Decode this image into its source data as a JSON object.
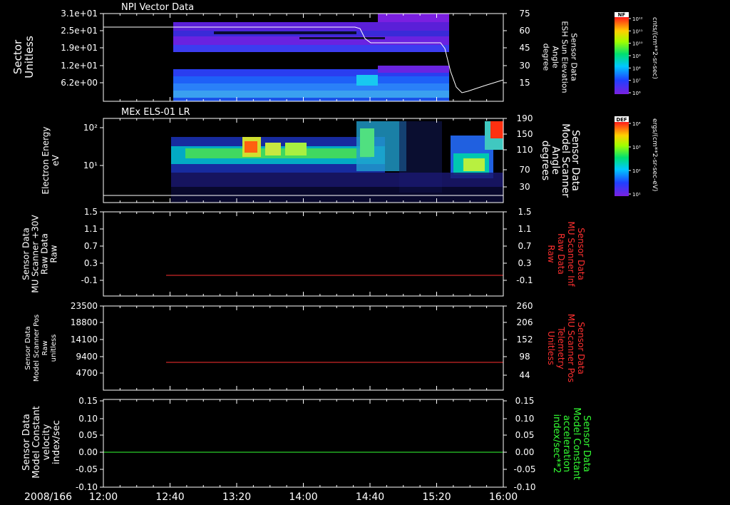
{
  "colors": {
    "background": "#000000",
    "axis": "#ffffff",
    "red_trace": "#ff3030",
    "green_trace": "#33ff33",
    "white_trace": "#ffffff"
  },
  "time_axis": {
    "date_label": "2008/166",
    "ticks": [
      "12:00",
      "12:40",
      "13:20",
      "14:00",
      "14:40",
      "15:20",
      "16:00"
    ]
  },
  "panels": [
    {
      "title": "NPI Vector Data",
      "left_label": [
        "Sector",
        "Unitless"
      ],
      "left_ticks": [
        "3.1e+01",
        "2.5e+01",
        "1.9e+01",
        "1.2e+01",
        "6.2e+00"
      ],
      "right_label": [
        "Sensor Data",
        "ESH Sun Elevation",
        "Angle",
        "degree"
      ],
      "right_ticks": [
        "75",
        "60",
        "45",
        "30",
        "15"
      ],
      "colorbar": {
        "label": "NF",
        "unit": "cnts/(cm**2-sr-sec)",
        "ticks": [
          "10¹²",
          "10¹¹",
          "10¹⁰",
          "10⁹",
          "10⁸",
          "10⁷",
          "10⁶"
        ]
      }
    },
    {
      "title": "MEx ELS-01 LR",
      "left_label": [
        "Electron Energy",
        "eV"
      ],
      "left_ticks": [
        "10²",
        "10¹"
      ],
      "right_label": [
        "Sensor Data",
        "Model Scanner",
        "Angle",
        "degrees"
      ],
      "right_ticks": [
        "190",
        "150",
        "110",
        "70",
        "30"
      ],
      "colorbar": {
        "label": "DEF",
        "unit": "ergs/(cm**2-sr-sec-eV)",
        "ticks": [
          "10⁴",
          "10³",
          "10²",
          "10¹"
        ]
      }
    },
    {
      "left_label": [
        "Sensor Data",
        "MU Scanner +30V",
        "Raw Data",
        "Raw"
      ],
      "left_ticks": [
        "1.5",
        "1.1",
        "0.7",
        "0.3",
        "-0.1"
      ],
      "right_label": [
        "Sensor Data",
        "MU Scanner Inf",
        "Raw Data",
        "Raw"
      ],
      "right_ticks": [
        "1.5",
        "1.1",
        "0.7",
        "0.3",
        "-0.1"
      ]
    },
    {
      "left_label": [
        "Sensor Data",
        "Model Scanner Pos",
        "Raw",
        "unitless"
      ],
      "left_ticks": [
        "23500",
        "18800",
        "14100",
        "9400",
        "4700"
      ],
      "right_label": [
        "Sensor Data",
        "MU Scanner Pos",
        "Telemetry",
        "Unitless"
      ],
      "right_ticks": [
        "260",
        "206",
        "152",
        "98",
        "44"
      ]
    },
    {
      "left_label": [
        "Sensor Data",
        "Model Constant",
        "velocity",
        "index/sec"
      ],
      "left_ticks": [
        "0.15",
        "0.10",
        "0.05",
        "0.00",
        "-0.05",
        "-0.10"
      ],
      "right_label": [
        "Sensor Data",
        "Model Constant",
        "acceleration",
        "index/sec**2"
      ],
      "right_ticks": [
        "0.15",
        "0.10",
        "0.05",
        "0.00",
        "-0.05",
        "-0.10"
      ]
    }
  ]
}
